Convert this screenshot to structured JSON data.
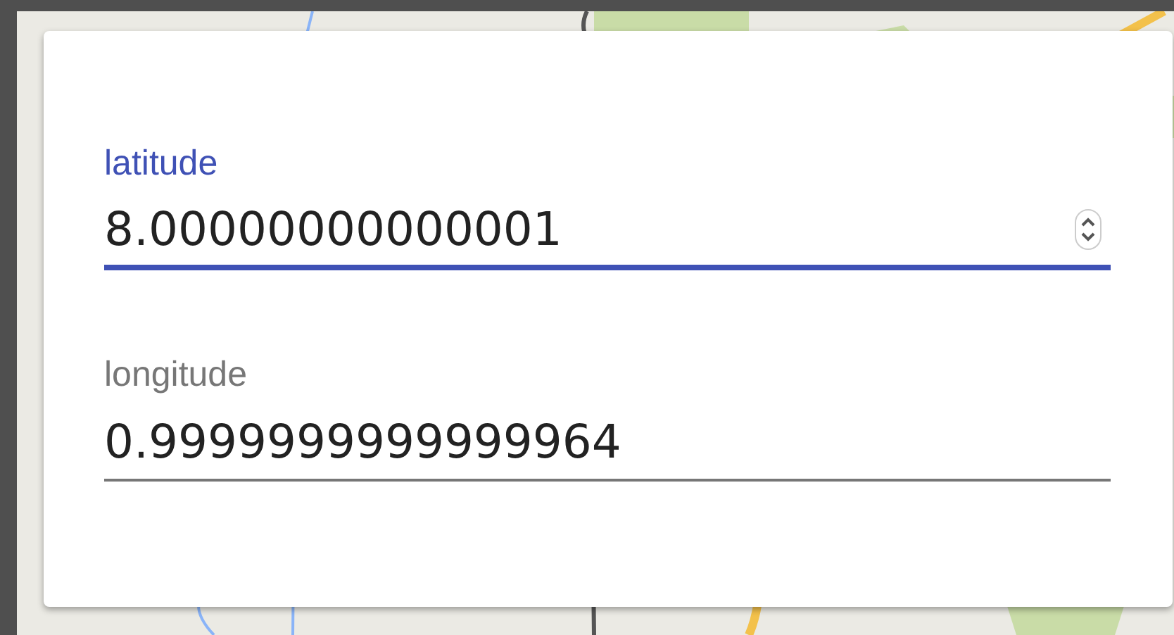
{
  "fields": [
    {
      "label": "latitude",
      "value": "8.00000000000001",
      "focused": true
    },
    {
      "label": "longitude",
      "value": "0.9999999999999964",
      "focused": false
    }
  ]
}
